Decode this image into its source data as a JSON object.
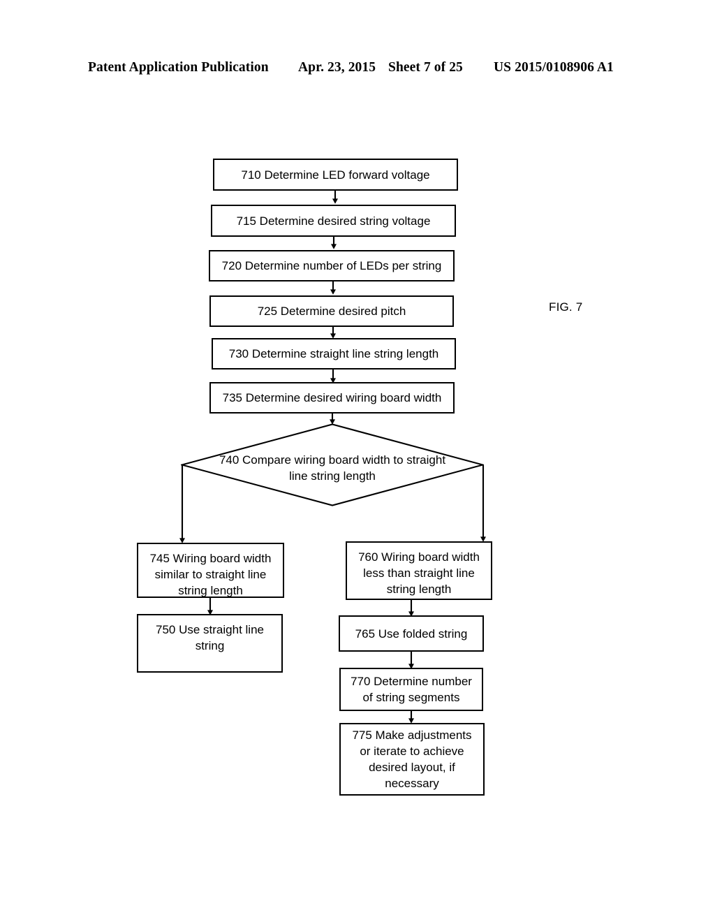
{
  "header": {
    "publication": "Patent Application Publication",
    "date": "Apr. 23, 2015",
    "sheet": "Sheet 7 of 25",
    "number": "US 2015/0108906 A1"
  },
  "figure": {
    "label": "FIG. 7"
  },
  "flowchart": {
    "nodes": [
      {
        "id": "710",
        "shape": "process",
        "text": "710  Determine LED forward voltage"
      },
      {
        "id": "715",
        "shape": "process",
        "text": "715  Determine desired string voltage"
      },
      {
        "id": "720",
        "shape": "process",
        "text": "720  Determine number of LEDs per string"
      },
      {
        "id": "725",
        "shape": "process",
        "text": "725  Determine desired pitch"
      },
      {
        "id": "730",
        "shape": "process",
        "text": "730 Determine straight line string length"
      },
      {
        "id": "735",
        "shape": "process",
        "text": "735  Determine desired wiring board width"
      },
      {
        "id": "740",
        "shape": "decision",
        "text": "740  Compare wiring board width to straight\nline string length"
      },
      {
        "id": "745",
        "shape": "process",
        "text": "745  Wiring board width\nsimilar to straight line\nstring length"
      },
      {
        "id": "750",
        "shape": "process",
        "text": "750  Use straight line\nstring"
      },
      {
        "id": "760",
        "shape": "process",
        "text": "760  Wiring board width\nless than straight line\nstring length"
      },
      {
        "id": "765",
        "shape": "process",
        "text": "765  Use folded string"
      },
      {
        "id": "770",
        "shape": "process",
        "text": "770  Determine number\nof string segments"
      },
      {
        "id": "775",
        "shape": "process",
        "text": "775  Make adjustments\nor iterate to achieve\ndesired layout, if\nnecessary"
      }
    ],
    "edges": [
      {
        "from": "710",
        "to": "715"
      },
      {
        "from": "715",
        "to": "720"
      },
      {
        "from": "720",
        "to": "725"
      },
      {
        "from": "725",
        "to": "730"
      },
      {
        "from": "730",
        "to": "735"
      },
      {
        "from": "735",
        "to": "740"
      },
      {
        "from": "740",
        "to": "745"
      },
      {
        "from": "740",
        "to": "760"
      },
      {
        "from": "745",
        "to": "750"
      },
      {
        "from": "760",
        "to": "765"
      },
      {
        "from": "765",
        "to": "770"
      },
      {
        "from": "770",
        "to": "775"
      }
    ]
  }
}
